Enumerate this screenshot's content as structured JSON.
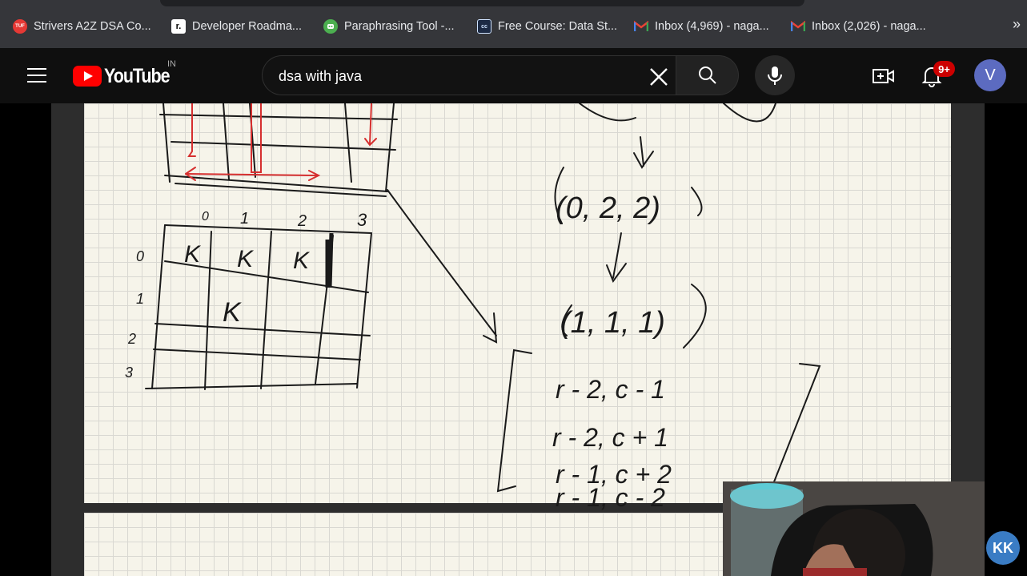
{
  "bookmarks": [
    {
      "label": "Strivers A2Z DSA Co...",
      "icon": "tuf-icon",
      "icon_text": "TUF",
      "color": "#e53935"
    },
    {
      "label": "Developer Roadma...",
      "icon": "roadmap-icon",
      "icon_text": "r.",
      "color": "#ffffff"
    },
    {
      "label": "Paraphrasing Tool -...",
      "icon": "robot-icon",
      "icon_text": "",
      "color": "#4caf50"
    },
    {
      "label": "Free Course: Data St...",
      "icon": "course-icon",
      "icon_text": "cc",
      "color": "#1a73e8"
    },
    {
      "label": "Inbox (4,969) - naga...",
      "icon": "gmail-icon",
      "icon_text": "M",
      "color": "#ea4335"
    },
    {
      "label": "Inbox (2,026) - naga...",
      "icon": "gmail-icon",
      "icon_text": "M",
      "color": "#ea4335"
    }
  ],
  "bookmarks_more": "»",
  "header": {
    "logo_text": "YouTube",
    "country": "IN",
    "search_value": "dsa with java",
    "notification_count": "9+",
    "avatar_letter": "V"
  },
  "video": {
    "board_text": {
      "col_headers": [
        "0",
        "1",
        "2",
        "3"
      ],
      "row_headers": [
        "0",
        "1",
        "2",
        "3"
      ],
      "cells": [
        "K",
        "K",
        "K",
        "K"
      ],
      "tuple1": "(0, 2, 2)",
      "tuple2": "(1, 1, 1)",
      "list": [
        "r - 2,   c - 1",
        "r - 2,   c + 1",
        "r - 1,   c + 2",
        "r - 1,   c - 2"
      ]
    },
    "overlay_logo": "KK"
  },
  "colors": {
    "brand_red": "#ff0000",
    "badge_red": "#cc0000",
    "avatar": "#5c6bc0",
    "ink": "#1a1a1a",
    "red_ink": "#d62f2f"
  }
}
